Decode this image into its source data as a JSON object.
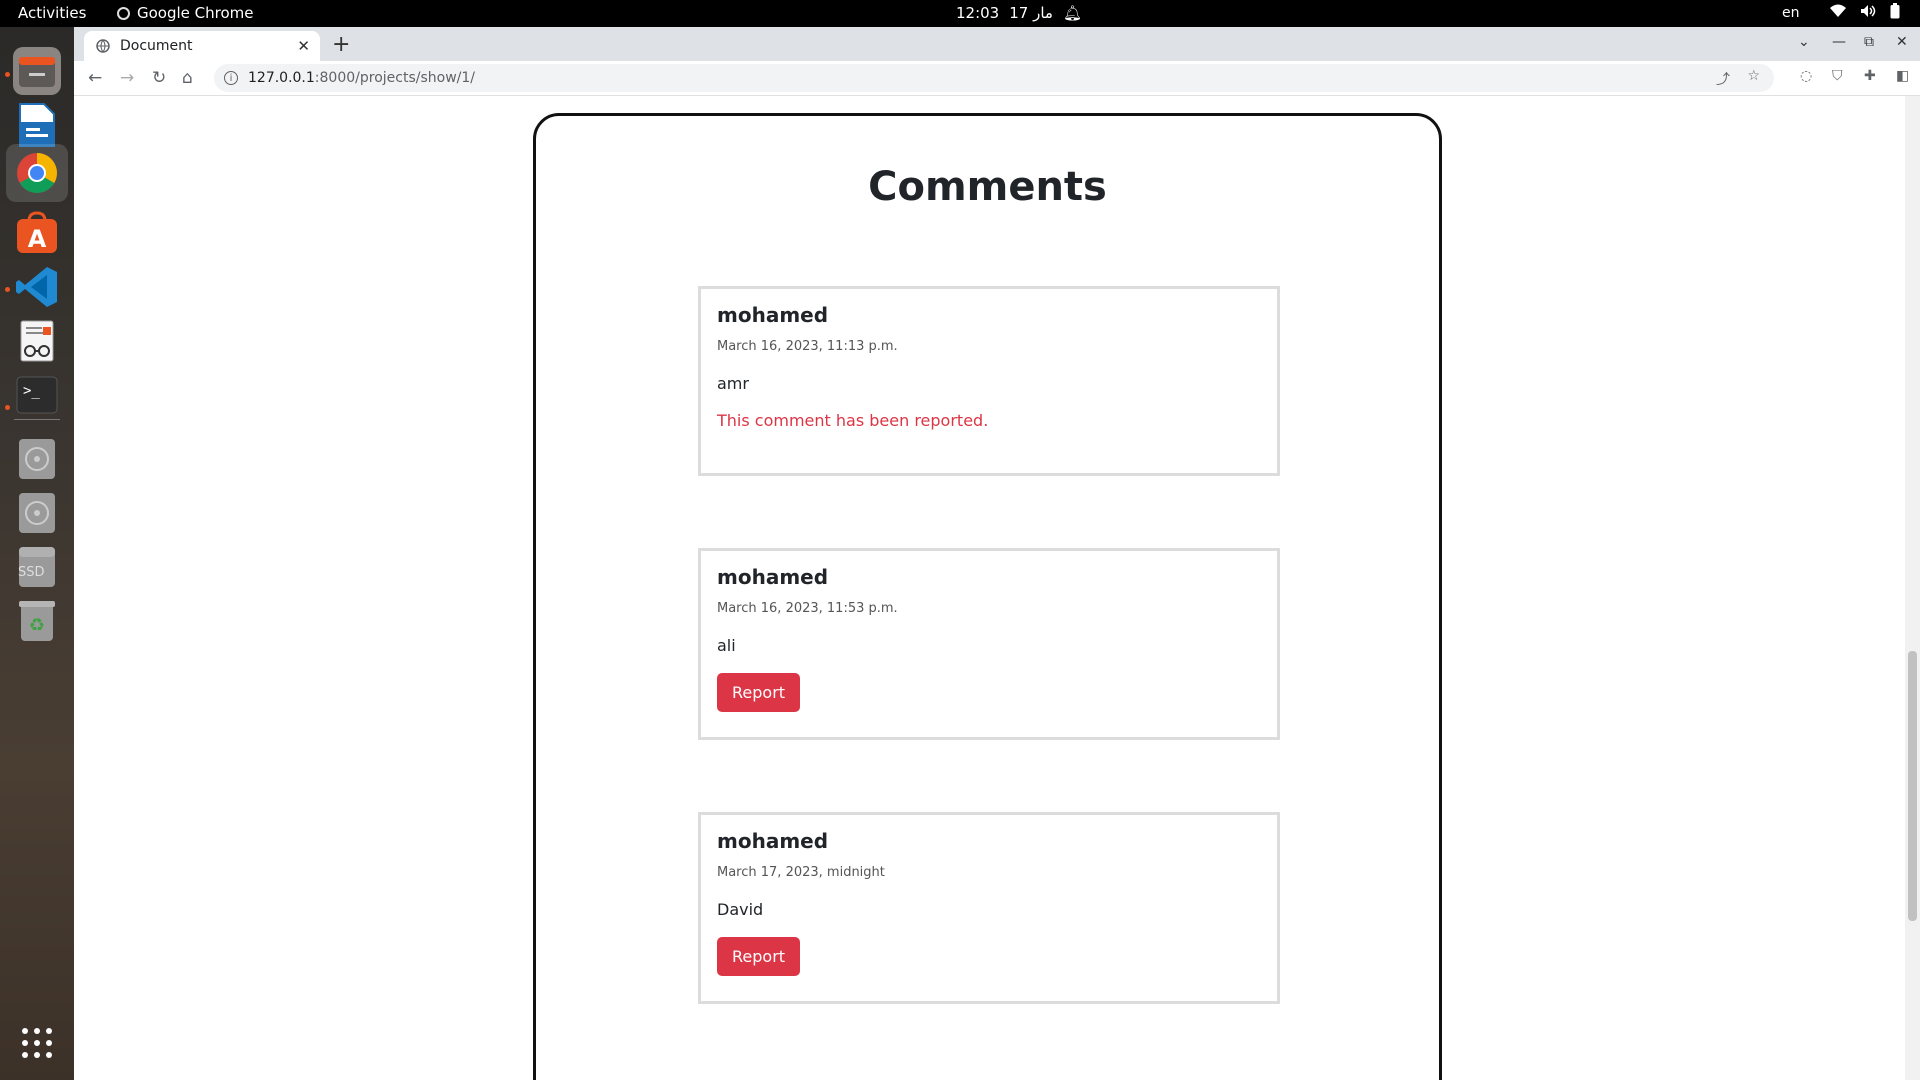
{
  "topbar": {
    "activities": "Activities",
    "app_name": "Google Chrome",
    "time": "12:03",
    "date": "17 مار",
    "lang": "en"
  },
  "dock": {
    "items": [
      {
        "name": "files-app",
        "icon": "folder-icon"
      },
      {
        "name": "writer-app",
        "icon": "document-icon"
      },
      {
        "name": "chrome-app",
        "icon": "chrome-icon"
      },
      {
        "name": "software-app",
        "icon": "software-center-icon"
      },
      {
        "name": "vscode-app",
        "icon": "vscode-icon"
      },
      {
        "name": "document-viewer-app",
        "icon": "reader-icon"
      },
      {
        "name": "terminal-app",
        "icon": "terminal-icon"
      },
      {
        "name": "disc-1",
        "icon": "disc-icon"
      },
      {
        "name": "disc-2",
        "icon": "disc-icon"
      },
      {
        "name": "ssd-drive",
        "icon": "drive-icon",
        "label": "SSD"
      },
      {
        "name": "trash",
        "icon": "trash-icon"
      }
    ],
    "accent": "#e95420"
  },
  "browser": {
    "tab_title": "Document",
    "url_host": "127.0.0.1",
    "url_path": ":8000/projects/show/1/"
  },
  "page": {
    "heading": "Comments",
    "comments": [
      {
        "author": "mohamed",
        "date": "March 16, 2023, 11:13 p.m.",
        "body": "amr",
        "reported_text": "This comment has been reported."
      },
      {
        "author": "mohamed",
        "date": "March 16, 2023, 11:53 p.m.",
        "body": "ali",
        "button": "Report"
      },
      {
        "author": "mohamed",
        "date": "March 17, 2023, midnight",
        "body": "David",
        "button": "Report"
      }
    ],
    "colors": {
      "danger": "#dc3545",
      "text": "#212529"
    }
  }
}
